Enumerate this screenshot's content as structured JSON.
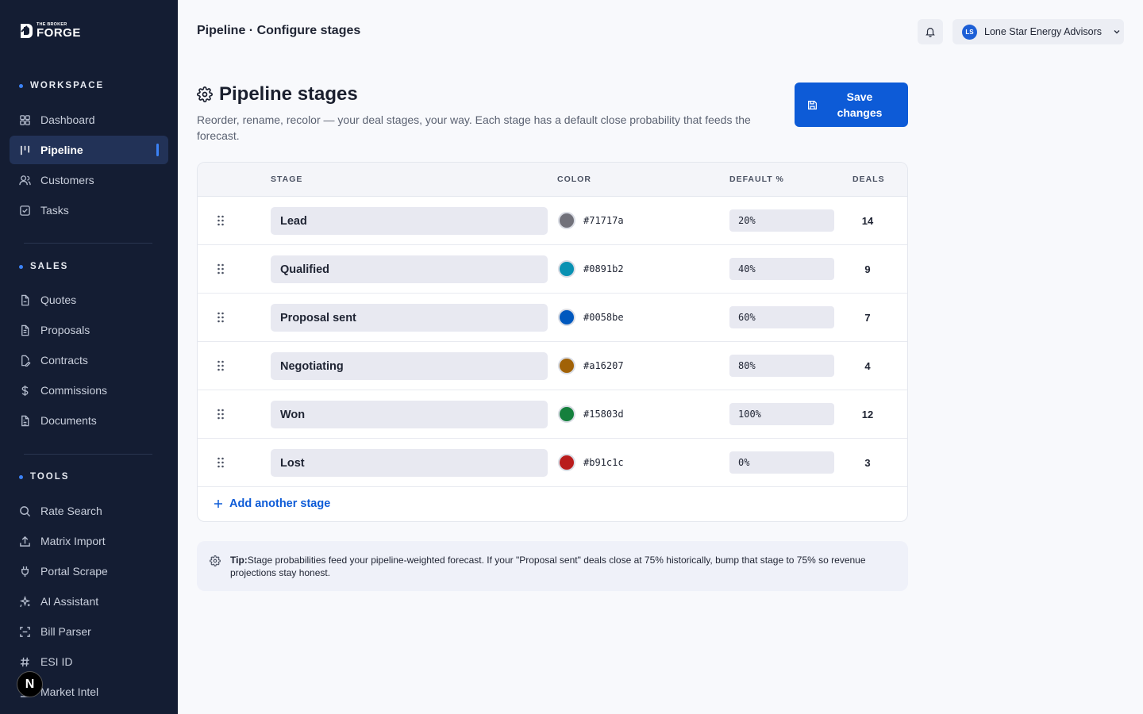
{
  "brand": {
    "small": "THE BROKER",
    "big": "FORGE"
  },
  "sidebar": {
    "sections": [
      {
        "title": "WORKSPACE",
        "items": [
          {
            "label": "Dashboard",
            "icon": "grid-icon"
          },
          {
            "label": "Pipeline",
            "icon": "kanban-icon",
            "active": true
          },
          {
            "label": "Customers",
            "icon": "users-icon"
          },
          {
            "label": "Tasks",
            "icon": "checkbox-icon"
          }
        ]
      },
      {
        "title": "SALES",
        "items": [
          {
            "label": "Quotes",
            "icon": "file-icon"
          },
          {
            "label": "Proposals",
            "icon": "file-text-icon"
          },
          {
            "label": "Contracts",
            "icon": "file-signature-icon"
          },
          {
            "label": "Commissions",
            "icon": "dollar-icon"
          },
          {
            "label": "Documents",
            "icon": "document-icon"
          }
        ]
      },
      {
        "title": "TOOLS",
        "items": [
          {
            "label": "Rate Search",
            "icon": "search-icon"
          },
          {
            "label": "Matrix Import",
            "icon": "upload-icon"
          },
          {
            "label": "Portal Scrape",
            "icon": "plug-icon"
          },
          {
            "label": "AI Assistant",
            "icon": "sparkles-icon"
          },
          {
            "label": "Bill Parser",
            "icon": "scan-icon"
          },
          {
            "label": "ESI ID",
            "icon": "hash-icon"
          },
          {
            "label": "Market Intel",
            "icon": "chart-icon"
          }
        ]
      }
    ],
    "badge": "N"
  },
  "header": {
    "crumb": "Pipeline · Configure stages",
    "account": {
      "initials": "LS",
      "name": "Lone Star Energy Advisors"
    }
  },
  "page": {
    "title": "Pipeline stages",
    "subtitle": "Reorder, rename, recolor — your deal stages, your way. Each stage has a default close probability that feeds the forecast.",
    "save_label": "Save changes"
  },
  "table": {
    "columns": {
      "stage": "STAGE",
      "color": "COLOR",
      "default": "DEFAULT %",
      "deals": "DEALS"
    },
    "rows": [
      {
        "stage": "Lead",
        "color": "#71717a",
        "pct": "20%",
        "deals": "14"
      },
      {
        "stage": "Qualified",
        "color": "#0891b2",
        "pct": "40%",
        "deals": "9"
      },
      {
        "stage": "Proposal sent",
        "color": "#0058be",
        "pct": "60%",
        "deals": "7"
      },
      {
        "stage": "Negotiating",
        "color": "#a16207",
        "pct": "80%",
        "deals": "4"
      },
      {
        "stage": "Won",
        "color": "#15803d",
        "pct": "100%",
        "deals": "12"
      },
      {
        "stage": "Lost",
        "color": "#b91c1c",
        "pct": "0%",
        "deals": "3"
      }
    ],
    "add_label": "Add another stage"
  },
  "tip": {
    "label": "Tip:",
    "text": "Stage probabilities feed your pipeline-weighted forecast. If your \"Proposal sent\" deals close at 75% historically, bump that stage to 75% so revenue projections stay honest."
  },
  "colors": {
    "accent": "#0d5bd7",
    "sidebar_bg": "#141d33"
  }
}
